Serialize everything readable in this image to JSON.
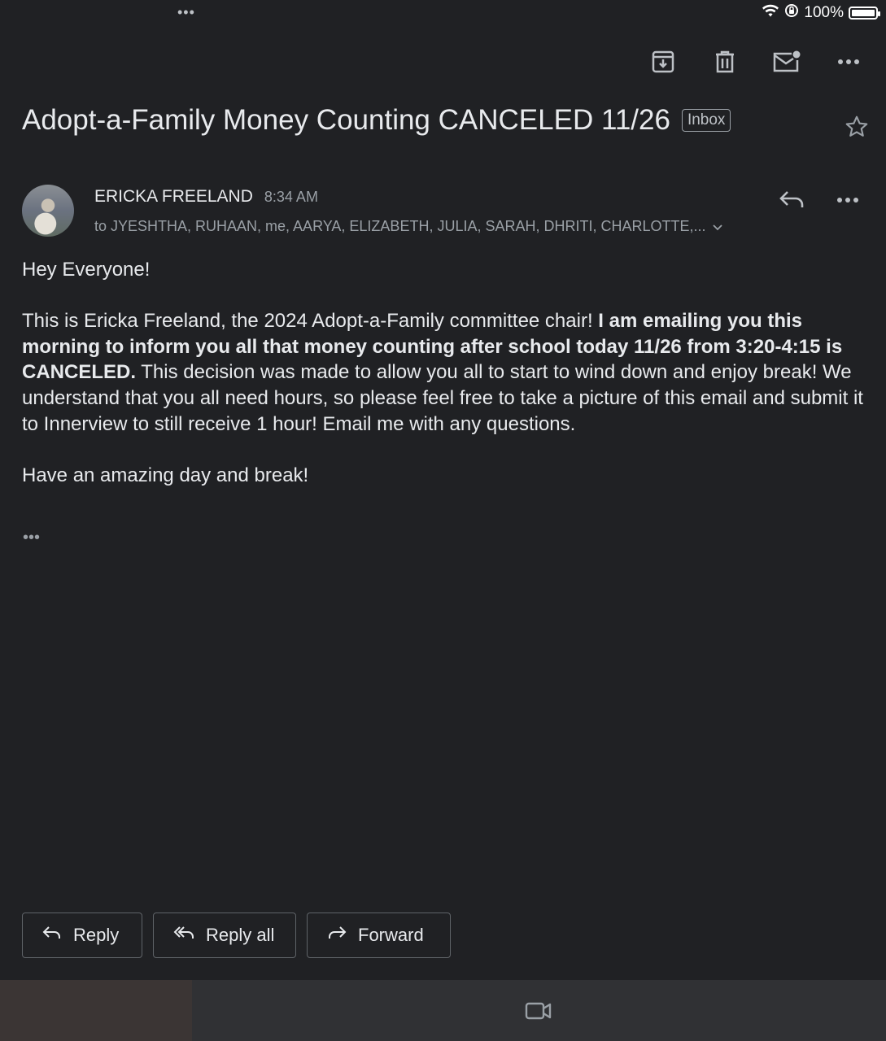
{
  "status_bar": {
    "dots": "•••",
    "battery_text": "100%",
    "battery_level": 1.0,
    "icons": [
      "wifi-icon",
      "rotation-lock-icon",
      "battery-icon"
    ]
  },
  "toolbar": {
    "icons": [
      "archive-icon",
      "delete-icon",
      "mark-unread-icon",
      "more-icon"
    ]
  },
  "email": {
    "subject": "Adopt-a-Family Money Counting CANCELED 11/26",
    "label": "Inbox",
    "sender": "ERICKA FREELAND",
    "time": "8:34 AM",
    "recipients": "to JYESHTHA, RUHAAN, me, AARYA, ELIZABETH, JULIA, SARAH, DHRITI, CHARLOTTE,...",
    "greeting": "Hey Everyone!",
    "para1_plain_a": "This is Ericka Freeland, the 2024 Adopt-a-Family committee chair! ",
    "para1_bold": "I am emailing you this morning to inform you all that money counting after school today 11/26 from 3:20-4:15 is CANCELED.",
    "para1_plain_b": " This decision was made to allow you all to start to wind down and enjoy break! We understand that you all need hours, so please feel free to take a picture of this email and submit it to Innerview to still receive 1 hour! Email me with any questions.",
    "closing": "Have an amazing day and break!",
    "trimmed": "•••"
  },
  "actions": {
    "reply_label": "Reply",
    "reply_all_label": "Reply all",
    "forward_label": "Forward"
  },
  "colors": {
    "background": "#202124",
    "text": "#e8eaed",
    "muted": "#9aa0a6",
    "border": "#5f6368"
  }
}
